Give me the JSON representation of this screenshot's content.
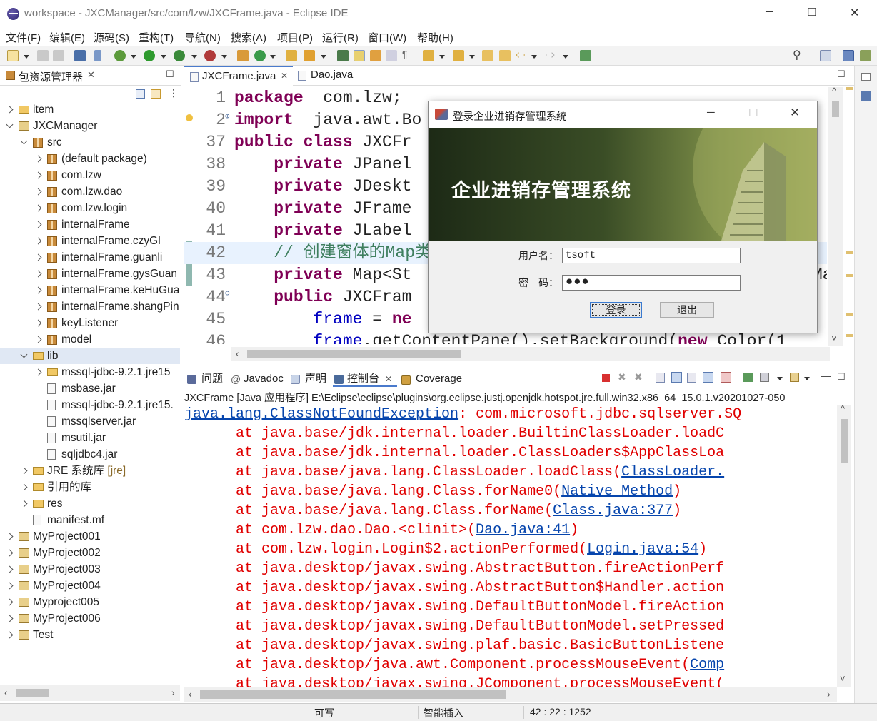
{
  "window": {
    "title": "workspace - JXCManager/src/com/lzw/JXCFrame.java - Eclipse IDE",
    "minimize": "─",
    "maximize": "☐",
    "close": "✕"
  },
  "menu": [
    "文件(F)",
    "编辑(E)",
    "源码(S)",
    "重构(T)",
    "导航(N)",
    "搜索(A)",
    "项目(P)",
    "运行(R)",
    "窗口(W)",
    "帮助(H)"
  ],
  "explorer": {
    "title": "包资源管理器",
    "rows": [
      {
        "label": "item",
        "indent": 0,
        "icon": "folder",
        "chev": "r"
      },
      {
        "label": "JXCManager",
        "indent": 0,
        "icon": "project",
        "chev": "d"
      },
      {
        "label": "src",
        "indent": 1,
        "icon": "srcfolder",
        "chev": "d"
      },
      {
        "label": "(default package)",
        "indent": 2,
        "icon": "package",
        "chev": "r"
      },
      {
        "label": "com.lzw",
        "indent": 2,
        "icon": "package",
        "chev": "r"
      },
      {
        "label": "com.lzw.dao",
        "indent": 2,
        "icon": "package",
        "chev": "r"
      },
      {
        "label": "com.lzw.login",
        "indent": 2,
        "icon": "package",
        "chev": "r"
      },
      {
        "label": "internalFrame",
        "indent": 2,
        "icon": "package",
        "chev": "r"
      },
      {
        "label": "internalFrame.czyGl",
        "indent": 2,
        "icon": "package",
        "chev": "r"
      },
      {
        "label": "internalFrame.guanli",
        "indent": 2,
        "icon": "package",
        "chev": "r"
      },
      {
        "label": "internalFrame.gysGuan",
        "indent": 2,
        "icon": "package",
        "chev": "r"
      },
      {
        "label": "internalFrame.keHuGua",
        "indent": 2,
        "icon": "package",
        "chev": "r"
      },
      {
        "label": "internalFrame.shangPin",
        "indent": 2,
        "icon": "package",
        "chev": "r"
      },
      {
        "label": "keyListener",
        "indent": 2,
        "icon": "package",
        "chev": "r"
      },
      {
        "label": "model",
        "indent": 2,
        "icon": "package",
        "chev": "r"
      },
      {
        "label": "lib",
        "indent": 1,
        "icon": "folder",
        "chev": "d",
        "selected": true
      },
      {
        "label": "mssql-jdbc-9.2.1.jre15",
        "indent": 2,
        "icon": "folder",
        "chev": "r"
      },
      {
        "label": "msbase.jar",
        "indent": 2,
        "icon": "jar",
        "chev": ""
      },
      {
        "label": "mssql-jdbc-9.2.1.jre15.",
        "indent": 2,
        "icon": "jar",
        "chev": ""
      },
      {
        "label": "mssqlserver.jar",
        "indent": 2,
        "icon": "jar",
        "chev": ""
      },
      {
        "label": "msutil.jar",
        "indent": 2,
        "icon": "jar",
        "chev": ""
      },
      {
        "label": "sqljdbc4.jar",
        "indent": 2,
        "icon": "jar",
        "chev": ""
      },
      {
        "label": "JRE 系统库",
        "suffix": "[jre]",
        "indent": 1,
        "icon": "lib",
        "chev": "r"
      },
      {
        "label": "引用的库",
        "indent": 1,
        "icon": "lib",
        "chev": "r"
      },
      {
        "label": "res",
        "indent": 1,
        "icon": "folder",
        "chev": "r"
      },
      {
        "label": "manifest.mf",
        "indent": 1,
        "icon": "jar",
        "chev": ""
      },
      {
        "label": "MyProject001",
        "indent": 0,
        "icon": "project",
        "chev": "r"
      },
      {
        "label": "MyProject002",
        "indent": 0,
        "icon": "project",
        "chev": "r"
      },
      {
        "label": "MyProject003",
        "indent": 0,
        "icon": "project",
        "chev": "r"
      },
      {
        "label": "MyProject004",
        "indent": 0,
        "icon": "project",
        "chev": "r"
      },
      {
        "label": "Myproject005",
        "indent": 0,
        "icon": "project",
        "chev": "r"
      },
      {
        "label": "MyProject006",
        "indent": 0,
        "icon": "project",
        "chev": "r"
      },
      {
        "label": "Test",
        "indent": 0,
        "icon": "project",
        "chev": "r"
      }
    ]
  },
  "editor": {
    "tabs": [
      "JXCFrame.java",
      "Dao.java"
    ],
    "lines": [
      {
        "n": "1",
        "parts": [
          [
            "kw",
            "package"
          ],
          [
            "",
            "  com.lzw;"
          ]
        ]
      },
      {
        "n": "2",
        "mark": "⊕",
        "parts": [
          [
            "kw",
            "import"
          ],
          [
            "",
            "  java.awt.Bo"
          ]
        ]
      },
      {
        "n": "37",
        "parts": [
          [
            "kw",
            "public class"
          ],
          [
            "",
            " JXCFr"
          ]
        ]
      },
      {
        "n": "38",
        "parts": [
          [
            "",
            "    "
          ],
          [
            "kw",
            "private"
          ],
          [
            "",
            " JPanel"
          ]
        ]
      },
      {
        "n": "39",
        "parts": [
          [
            "",
            "    "
          ],
          [
            "kw",
            "private"
          ],
          [
            "",
            " JDeskt"
          ]
        ]
      },
      {
        "n": "40",
        "parts": [
          [
            "",
            "    "
          ],
          [
            "kw",
            "private"
          ],
          [
            "",
            " JFrame"
          ]
        ]
      },
      {
        "n": "41",
        "parts": [
          [
            "",
            "    "
          ],
          [
            "kw",
            "private"
          ],
          [
            "",
            " JLabel"
          ]
        ]
      },
      {
        "n": "42",
        "highlight": true,
        "parts": [
          [
            "",
            "    "
          ],
          [
            "cm",
            "// 创建窗体的Map类"
          ]
        ]
      },
      {
        "n": "43",
        "parts": [
          [
            "",
            "    "
          ],
          [
            "kw",
            "private"
          ],
          [
            "",
            " Map<St"
          ]
        ]
      },
      {
        "n": "44",
        "mark": "⊖",
        "parts": [
          [
            "",
            "    "
          ],
          [
            "kw",
            "public"
          ],
          [
            "",
            " JXCFram"
          ]
        ]
      },
      {
        "n": "45",
        "parts": [
          [
            "",
            "        "
          ],
          [
            "fld",
            "frame"
          ],
          [
            "",
            " = "
          ],
          [
            "kw",
            "ne"
          ]
        ]
      },
      {
        "n": "46",
        "parts": [
          [
            "",
            "        "
          ],
          [
            "fld",
            "frame"
          ],
          [
            "",
            ".getContentPane().setBackground("
          ],
          [
            "kw",
            "new"
          ],
          [
            "",
            " Color(1"
          ]
        ]
      }
    ],
    "overflow_ma": "Ma"
  },
  "console": {
    "tabs": [
      "问题",
      "Javadoc",
      "声明",
      "控制台",
      "Coverage"
    ],
    "header": "JXCFrame [Java 应用程序] E:\\Eclipse\\eclipse\\plugins\\org.eclipse.justj.openjdk.hotspot.jre.full.win32.x86_64_15.0.1.v20201027-050",
    "lines": [
      {
        "pre": "",
        "link1": "java.lang.ClassNotFoundException",
        "mid": ": com.microsoft.jdbc.sqlserver.SQ",
        "link2": "",
        "post": ""
      },
      {
        "pre": "      at java.base/jdk.internal.loader.BuiltinClassLoader.loadC",
        "link1": "",
        "mid": "",
        "link2": "",
        "post": ""
      },
      {
        "pre": "      at java.base/jdk.internal.loader.ClassLoaders$AppClassLoa",
        "link1": "",
        "mid": "",
        "link2": "",
        "post": ""
      },
      {
        "pre": "      at java.base/java.lang.ClassLoader.loadClass(",
        "link1": "ClassLoader.",
        "mid": "",
        "link2": "",
        "post": ""
      },
      {
        "pre": "      at java.base/java.lang.Class.forName0(",
        "link1": "Native Method",
        "mid": ")",
        "link2": "",
        "post": ""
      },
      {
        "pre": "      at java.base/java.lang.Class.forName(",
        "link1": "Class.java:377",
        "mid": ")",
        "link2": "",
        "post": ""
      },
      {
        "pre": "      at com.lzw.dao.Dao.<clinit>(",
        "link1": "Dao.java:41",
        "mid": ")",
        "link2": "",
        "post": ""
      },
      {
        "pre": "      at com.lzw.login.Login$2.actionPerformed(",
        "link1": "Login.java:54",
        "mid": ")",
        "link2": "",
        "post": ""
      },
      {
        "pre": "      at java.desktop/javax.swing.AbstractButton.fireActionPerf",
        "link1": "",
        "mid": "",
        "link2": "",
        "post": ""
      },
      {
        "pre": "      at java.desktop/javax.swing.AbstractButton$Handler.action",
        "link1": "",
        "mid": "",
        "link2": "",
        "post": ""
      },
      {
        "pre": "      at java.desktop/javax.swing.DefaultButtonModel.fireAction",
        "link1": "",
        "mid": "",
        "link2": "",
        "post": ""
      },
      {
        "pre": "      at java.desktop/javax.swing.DefaultButtonModel.setPressed",
        "link1": "",
        "mid": "",
        "link2": "",
        "post": ""
      },
      {
        "pre": "      at java.desktop/javax.swing.plaf.basic.BasicButtonListene",
        "link1": "",
        "mid": "",
        "link2": "",
        "post": ""
      },
      {
        "pre": "      at java.desktop/java.awt.Component.processMouseEvent(",
        "link1": "Comp",
        "mid": "",
        "link2": "",
        "post": ""
      },
      {
        "pre": "      at java.desktop/javax.swing.JComponent.processMouseEvent(",
        "link1": "",
        "mid": "",
        "link2": "",
        "post": ""
      }
    ]
  },
  "status": {
    "writable": "可写",
    "insert_mode": "智能插入",
    "position": "42 : 22 : 1252"
  },
  "dialog": {
    "title": "登录企业进销存管理系统",
    "banner_title": "企业进销存管理系统",
    "username_label": "用户名：",
    "username_value": "tsoft",
    "password_label": "密　码：",
    "password_value": "●●●",
    "login_button": "登录",
    "exit_button": "退出"
  }
}
